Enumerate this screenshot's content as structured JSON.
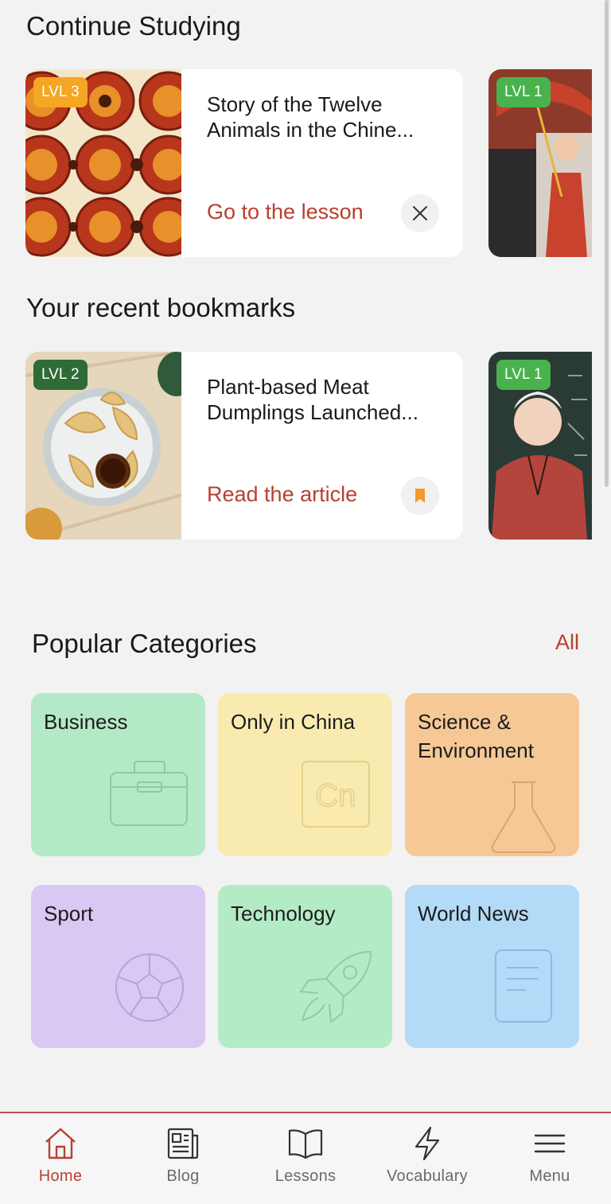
{
  "continue_studying": {
    "title": "Continue Studying",
    "card": {
      "level": "LVL 3",
      "title": "Story of the Twelve Animals in the Chine...",
      "action": "Go to the lesson",
      "button_icon": "close-icon"
    },
    "peek_card": {
      "level": "LVL 1"
    }
  },
  "bookmarks": {
    "title": "Your recent bookmarks",
    "card": {
      "level": "LVL 2",
      "title": "Plant-based Meat Dumplings Launched...",
      "action": "Read the article",
      "button_icon": "bookmark-icon"
    },
    "peek_card": {
      "level": "LVL 1"
    }
  },
  "categories": {
    "title": "Popular Categories",
    "all_link": "All",
    "items": [
      {
        "label": "Business",
        "icon": "briefcase-icon",
        "color": "#b3e9c7"
      },
      {
        "label": "Only in China",
        "icon": "cn-icon",
        "color": "#f9ebaf"
      },
      {
        "label": "Science & Environment",
        "icon": "flask-icon",
        "color": "#f5c896"
      },
      {
        "label": "Sport",
        "icon": "soccer-ball-icon",
        "color": "#d9c8f4"
      },
      {
        "label": "Technology",
        "icon": "rocket-icon",
        "color": "#b4ebc7"
      },
      {
        "label": "World News",
        "icon": "document-icon",
        "color": "#b3daf7"
      }
    ]
  },
  "tabbar": {
    "items": [
      {
        "label": "Home",
        "icon": "home-icon",
        "active": true
      },
      {
        "label": "Blog",
        "icon": "newspaper-icon",
        "active": false
      },
      {
        "label": "Lessons",
        "icon": "book-icon",
        "active": false
      },
      {
        "label": "Vocabulary",
        "icon": "lightning-icon",
        "active": false
      },
      {
        "label": "Menu",
        "icon": "menu-icon",
        "active": false
      }
    ]
  },
  "colors": {
    "accent": "#b7402f",
    "level_orange": "#f5a623",
    "level_green": "#49b24c",
    "level_dark_green": "#2e6b35",
    "bookmark": "#f29a2e"
  }
}
